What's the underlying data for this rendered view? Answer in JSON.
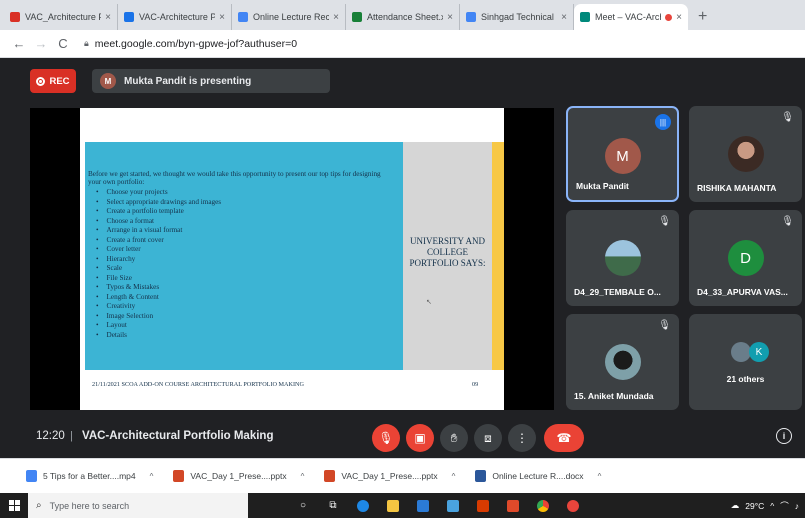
{
  "browser": {
    "tabs": [
      {
        "title": "VAC_Architecture Port",
        "fav_color": "#d93025",
        "active": false
      },
      {
        "title": "VAC-Architecture Port",
        "fav_color": "#1a73e8",
        "active": false
      },
      {
        "title": "Online Lecture Record",
        "fav_color": "#4285f4",
        "active": false
      },
      {
        "title": "Attendance Sheet.xlsx",
        "fav_color": "#188038",
        "active": false
      },
      {
        "title": "Sinhgad Technical Edu",
        "fav_color": "#4285f4",
        "active": false
      },
      {
        "title": "Meet – VAC-Archi",
        "fav_color": "#00897b",
        "active": true
      }
    ],
    "new_tab_label": "+",
    "close_label": "×",
    "url": "meet.google.com/byn-gpwe-jof?authuser=0"
  },
  "meet": {
    "rec_label": "REC",
    "presenter_initial": "M",
    "presenting_text": "Mukta Pandit is presenting",
    "time": "12:20",
    "separator": "|",
    "meeting_title": "VAC-Architectural Portfolio Making"
  },
  "slide": {
    "intro": "Before we get started, we thought we would take this opportunity to present our top tips for designing your own portfolio:",
    "tips": [
      "Choose your projects",
      "Select appropriate drawings and images",
      "Create a portfolio template",
      "Choose a format",
      "Arrange in a visual format",
      "Create a front cover",
      "Cover letter",
      "Hierarchy",
      "Scale",
      "File Size",
      "Typos & Mistakes",
      "Length & Content",
      "Creativity",
      "Image Selection",
      "Layout",
      "Details"
    ],
    "heading": "UNIVERSITY AND COLLEGE PORTFOLIO SAYS:",
    "footer": "21/11/2021 SCOA ADD-ON COURSE ARCHITECTURAL PORTFOLIO MAKING",
    "page": "09"
  },
  "participants": [
    {
      "name": "Mukta Pandit",
      "initial": "M",
      "color": "#a1584a",
      "speaking": true,
      "muted": false
    },
    {
      "name": "RISHIKA MAHANTA",
      "initial": "",
      "color": "#6b4a3e",
      "speaking": false,
      "muted": true
    },
    {
      "name": "D4_29_TEMBALE O...",
      "initial": "",
      "color": "#5a8fb0",
      "speaking": false,
      "muted": true
    },
    {
      "name": "D4_33_APURVA VAS...",
      "initial": "D",
      "color": "#1e8e3e",
      "speaking": false,
      "muted": true
    },
    {
      "name": "15. Aniket Mundada",
      "initial": "",
      "color": "#2d3b3f",
      "speaking": false,
      "muted": true
    },
    {
      "name": "21 others",
      "initial": "K",
      "color": "#129eaf",
      "speaking": false,
      "muted": false
    }
  ],
  "controls": {
    "mic_icon": "mic-off-icon",
    "camera_icon": "camera-off-icon",
    "hand_icon": "raise-hand-icon",
    "present_icon": "present-icon",
    "more_icon": "more-vert-icon",
    "end_icon": "end-call-icon",
    "info_label": "i"
  },
  "downloads": [
    {
      "name": "5 Tips for a Better....mp4",
      "color": "#4285f4"
    },
    {
      "name": "VAC_Day 1_Prese....pptx",
      "color": "#d24726"
    },
    {
      "name": "VAC_Day 1_Prese....pptx",
      "color": "#d24726"
    },
    {
      "name": "Online Lecture R....docx",
      "color": "#2b579a"
    }
  ],
  "taskbar": {
    "search_placeholder": "Type here to search",
    "temperature": "29°C",
    "tray_caret": "^"
  },
  "colors": {
    "meet_bg": "#202124",
    "tile_bg": "#3c4043",
    "danger": "#ea4335",
    "accent": "#8ab4f8"
  }
}
